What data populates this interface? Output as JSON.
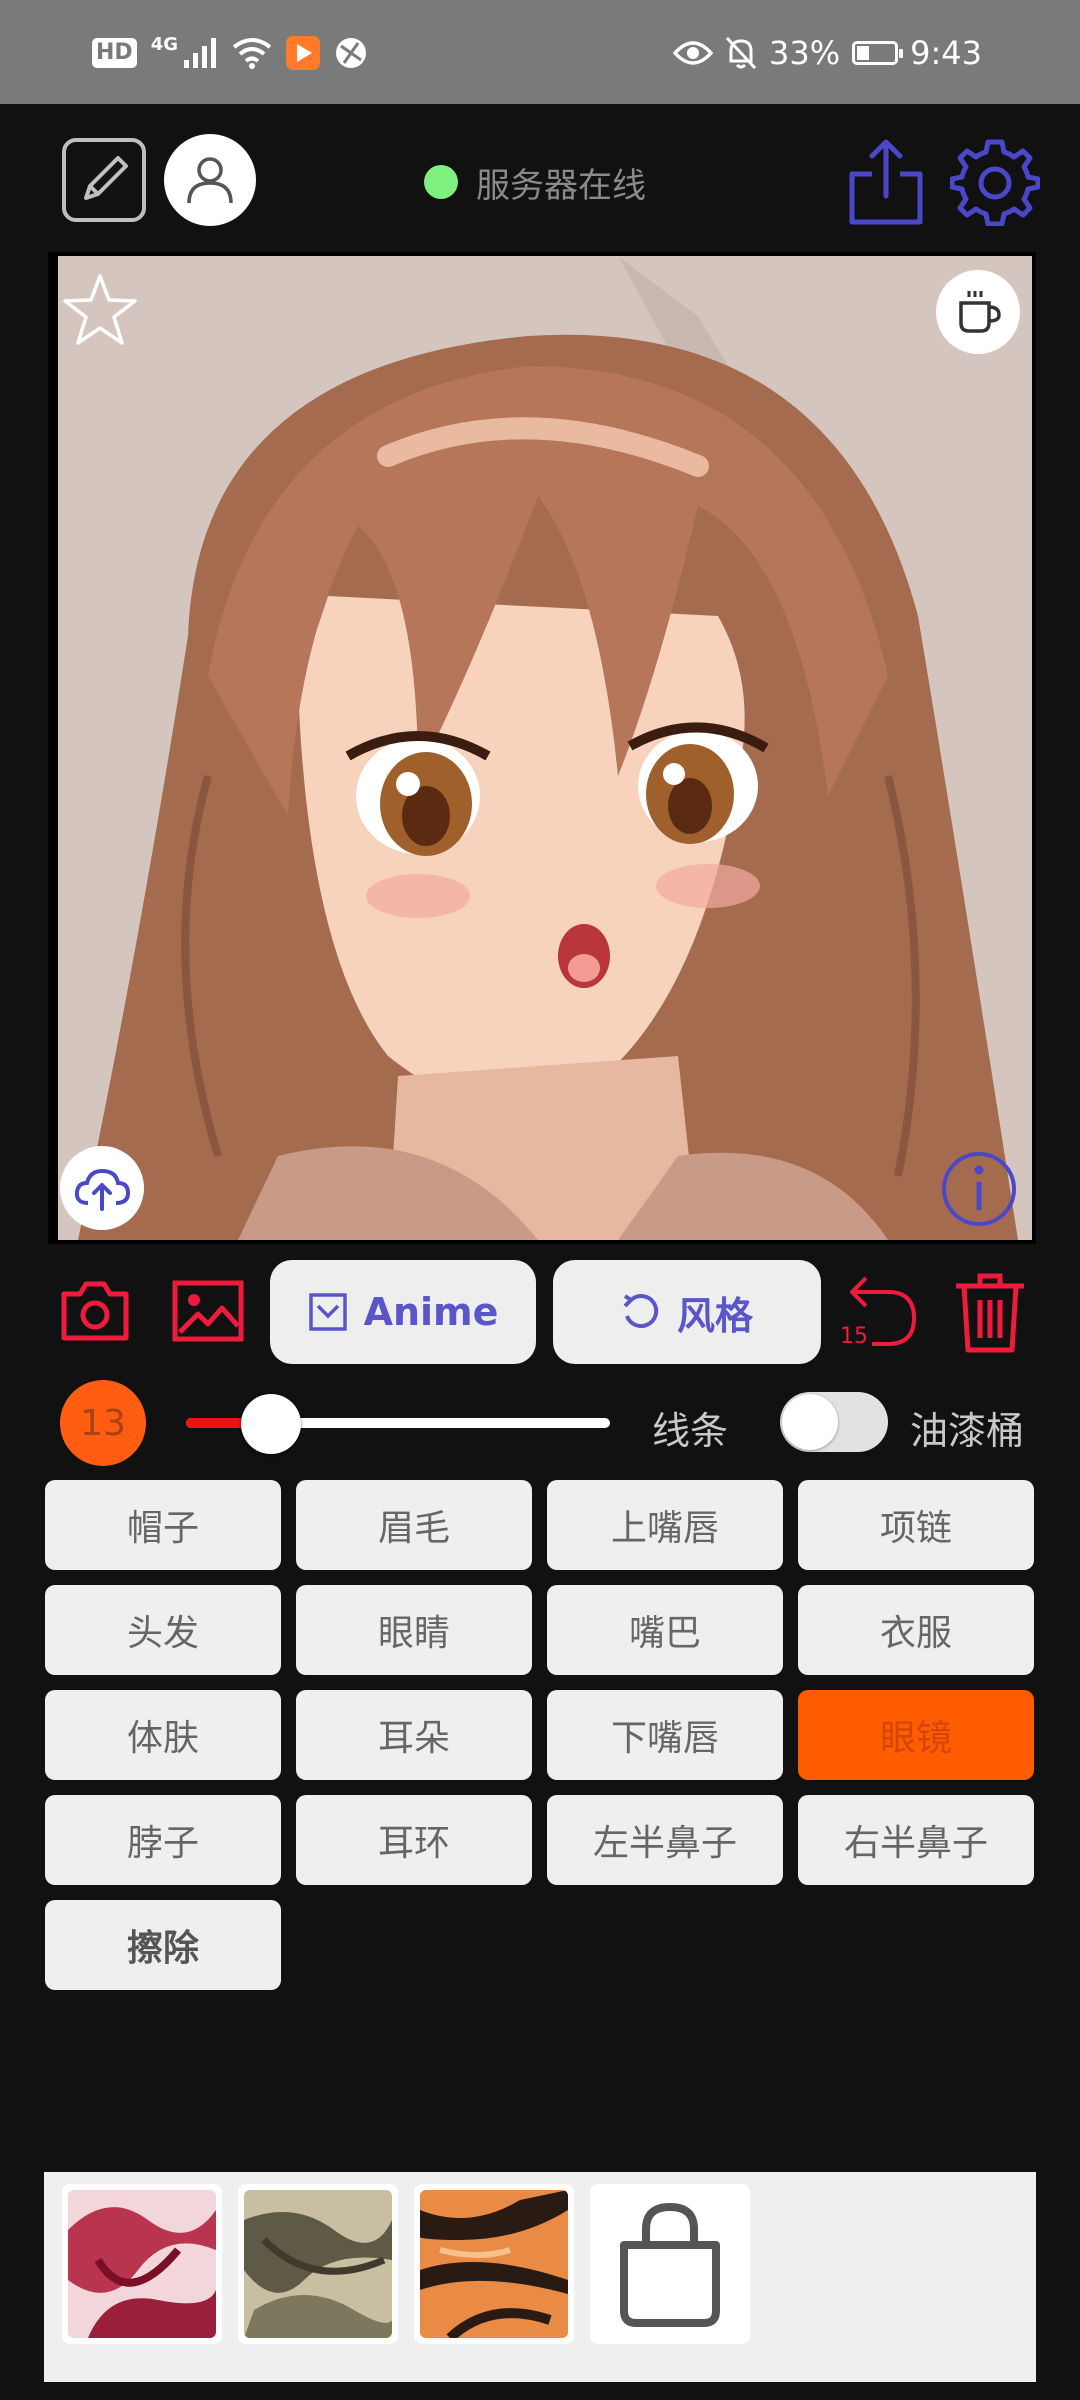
{
  "status_bar": {
    "hd": "HD",
    "network": "4G",
    "battery_percent": "33%",
    "battery_level": 0.33,
    "time": "9:43",
    "icons": [
      "signal-icon",
      "wifi-icon",
      "video-app-icon",
      "browser-app-icon",
      "eye-icon",
      "bell-off-icon"
    ]
  },
  "toolbar": {
    "server_status": "服务器在线",
    "server_status_color": "#7ef07e",
    "icons": [
      "sketch-mode-icon",
      "user-icon",
      "share-icon",
      "settings-icon"
    ]
  },
  "canvas": {
    "overlay_icons": [
      "star-icon",
      "coffee-cup-icon",
      "cloud-upload-icon",
      "info-icon"
    ]
  },
  "actions": {
    "anime_label": "Anime",
    "style_label": "风格",
    "undo_count": "15",
    "icons": [
      "camera-icon",
      "gallery-icon",
      "checkbox-icon",
      "rotate-icon",
      "undo-icon",
      "trash-icon"
    ]
  },
  "brush": {
    "size": "13",
    "slider_fraction": 0.2,
    "lines_label": "线条",
    "paint_bucket_label": "油漆桶",
    "paint_bucket_enabled": false
  },
  "parts": {
    "selected": "眼镜",
    "items": [
      "帽子",
      "眉毛",
      "上嘴唇",
      "项链",
      "头发",
      "眼睛",
      "嘴巴",
      "衣服",
      "体肤",
      "耳朵",
      "下嘴唇",
      "眼镜",
      "脖子",
      "耳环",
      "左半鼻子",
      "右半鼻子",
      "擦除"
    ]
  },
  "textures": {
    "count": 3,
    "store_icon": "shopping-bag-icon"
  },
  "colors": {
    "accent_red": "#ee1b3c",
    "accent_blue": "#5a55c8",
    "selected_orange": "#ff5c00"
  }
}
